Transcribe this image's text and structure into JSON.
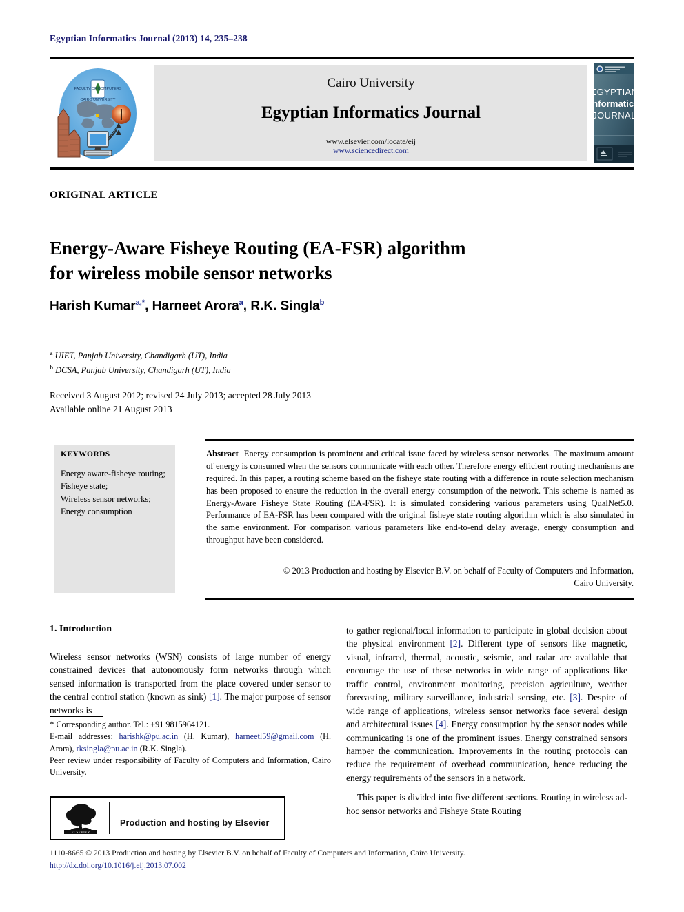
{
  "running_head": "Egyptian Informatics Journal (2013) 14, 235–238",
  "masthead": {
    "university": "Cairo University",
    "journal": "Egyptian Informatics Journal",
    "url_elsevier": "www.elsevier.com/locate/eij",
    "url_sciencedirect": "www.sciencedirect.com",
    "left_logo_name": "faculty-of-computers-and-information-cairo-university-logo",
    "right_cover_line1": "EGYPTIAN",
    "right_cover_line2": "Informatics",
    "right_cover_line3": "JOURNAL"
  },
  "article": {
    "type_label": "ORIGINAL ARTICLE",
    "title_line1": "Energy-Aware Fisheye Routing (EA-FSR) algorithm",
    "title_line2": "for wireless mobile sensor networks",
    "authors": [
      {
        "name": "Harish Kumar",
        "marks": "a,*"
      },
      {
        "name": "Harneet Arora",
        "marks": "a"
      },
      {
        "name": "R.K. Singla",
        "marks": "b"
      }
    ],
    "affiliations": [
      {
        "mark": "a",
        "text": "UIET, Panjab University, Chandigarh (UT), India"
      },
      {
        "mark": "b",
        "text": "DCSA, Panjab University, Chandigarh (UT), India"
      }
    ],
    "received_line": "Received 3 August 2012; revised 24 July 2013; accepted 28 July 2013",
    "available_line": "Available online 21 August 2013"
  },
  "keywords": {
    "heading": "KEYWORDS",
    "items": [
      "Energy aware-fisheye routing;",
      "Fisheye state;",
      "Wireless sensor networks;",
      "Energy consumption"
    ]
  },
  "abstract": {
    "label": "Abstract",
    "text": "Energy consumption is prominent and critical issue faced by wireless sensor networks. The maximum amount of energy is consumed when the sensors communicate with each other. Therefore energy efficient routing mechanisms are required. In this paper, a routing scheme based on the fisheye state routing with a difference in route selection mechanism has been proposed to ensure the reduction in the overall energy consumption of the network. This scheme is named as Energy-Aware Fisheye State Routing (EA-FSR). It is simulated considering various parameters using QualNet5.0. Performance of EA-FSR has been compared with the original fisheye state routing algorithm which is also simulated in the same environment. For comparison various parameters like end-to-end delay average, energy consumption and throughput have been considered.",
    "copyright_line1": "© 2013 Production and hosting by Elsevier B.V. on behalf of Faculty of Computers and Information,",
    "copyright_line2": "Cairo University."
  },
  "body": {
    "section_heading": "1. Introduction",
    "left_para_1_a": "Wireless sensor networks (WSN) consists of large number of energy constrained devices that autonomously form networks through which sensed information is transported from the place covered under sensor to the central control station (known as sink) ",
    "left_para_1_ref": "[1]",
    "left_para_1_b": ". The major purpose of sensor networks is",
    "right_para_1_a": "to gather regional/local information to participate in global decision about the physical environment ",
    "right_para_1_ref1": "[2]",
    "right_para_1_b": ". Different type of sensors like magnetic, visual, infrared, thermal, acoustic, seismic, and radar are available that encourage the use of these networks in wide range of applications like traffic control, environment monitoring, precision agriculture, weather forecasting, military surveillance, industrial sensing, etc. ",
    "right_para_1_ref2": "[3]",
    "right_para_1_c": ". Despite of wide range of applications, wireless sensor networks face several design and architectural issues ",
    "right_para_1_ref3": "[4]",
    "right_para_1_d": ". Energy consumption by the sensor nodes while communicating is one of the prominent issues. Energy constrained sensors hamper the communication. Improvements in the routing protocols can reduce the requirement of overhead communication, hence reducing the energy requirements of the sensors in a network.",
    "right_para_2": "This paper is divided into five different sections. Routing in wireless ad-hoc sensor networks and Fisheye State Routing"
  },
  "footnote": {
    "corresponding": "Corresponding author. Tel.: +91 9815964121.",
    "email_label": "E-mail addresses:",
    "email1": "harishk@pu.ac.in",
    "email1_owner": "(H. Kumar),",
    "email2": "harneetl59@gmail.com",
    "email2_owner": "(H. Arora),",
    "email3": "rksingla@pu.ac.in",
    "email3_owner": "(R.K. Singla).",
    "peer_review": "Peer review under responsibility of Faculty of Computers and Information, Cairo University."
  },
  "elsevier_box": {
    "label": "Production and hosting by Elsevier",
    "logo_word": "ELSEVIER"
  },
  "footer": {
    "issn_line": "1110-8665 © 2013 Production and hosting by Elsevier B.V. on behalf of Faculty of Computers and Information, Cairo University.",
    "doi": "http://dx.doi.org/10.1016/j.eij.2013.07.002"
  },
  "colors": {
    "link_blue": "#1c2a8c",
    "band_gray": "#e4e4e4",
    "rule_black": "#000000"
  }
}
